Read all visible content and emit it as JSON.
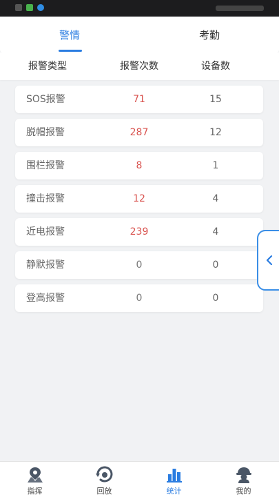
{
  "tabs": {
    "items": [
      {
        "label": "警情",
        "active": true
      },
      {
        "label": "考勤",
        "active": false
      }
    ]
  },
  "table": {
    "headers": [
      "报警类型",
      "报警次数",
      "设备数"
    ],
    "rows": [
      {
        "type": "SOS报警",
        "count": "71",
        "devices": "15"
      },
      {
        "type": "脱帽报警",
        "count": "287",
        "devices": "12"
      },
      {
        "type": "围栏报警",
        "count": "8",
        "devices": "1"
      },
      {
        "type": "撞击报警",
        "count": "12",
        "devices": "4"
      },
      {
        "type": "近电报警",
        "count": "239",
        "devices": "4"
      },
      {
        "type": "静默报警",
        "count": "0",
        "devices": "0"
      },
      {
        "type": "登高报警",
        "count": "0",
        "devices": "0"
      }
    ]
  },
  "bottom_nav": {
    "items": [
      {
        "label": "指挥",
        "icon": "map-pin-icon",
        "active": false
      },
      {
        "label": "回放",
        "icon": "replay-icon",
        "active": false
      },
      {
        "label": "统计",
        "icon": "bar-chart-icon",
        "active": true
      },
      {
        "label": "我的",
        "icon": "user-helmet-icon",
        "active": false
      }
    ]
  },
  "colors": {
    "accent": "#2b7de1",
    "alert_count": "#d9534f"
  }
}
